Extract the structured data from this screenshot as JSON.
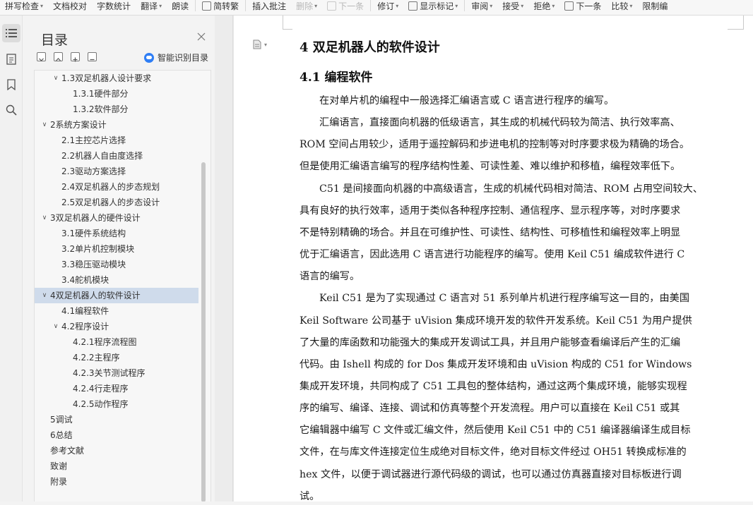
{
  "toolbar": {
    "items": [
      {
        "label": "拼写检查",
        "caret": true,
        "disabled": false,
        "icon": false
      },
      {
        "label": "文档校对",
        "caret": false,
        "disabled": false,
        "icon": false
      },
      {
        "label": "字数统计",
        "caret": false,
        "disabled": false,
        "icon": false
      },
      {
        "label": "翻译",
        "caret": true,
        "disabled": false,
        "icon": false
      },
      {
        "label": "朗读",
        "caret": false,
        "disabled": false,
        "icon": false
      },
      {
        "label": "简转繁",
        "caret": false,
        "disabled": false,
        "icon": true
      },
      {
        "label": "插入批注",
        "caret": false,
        "disabled": false,
        "icon": false
      },
      {
        "label": "删除",
        "caret": true,
        "disabled": true,
        "icon": false
      },
      {
        "label": "下一条",
        "caret": false,
        "disabled": true,
        "icon": true
      },
      {
        "label": "修订",
        "caret": true,
        "disabled": false,
        "icon": false
      },
      {
        "label": "显示标记",
        "caret": true,
        "disabled": false,
        "icon": true
      },
      {
        "label": "审阅",
        "caret": true,
        "disabled": false,
        "icon": false
      },
      {
        "label": "接受",
        "caret": true,
        "disabled": false,
        "icon": false
      },
      {
        "label": "拒绝",
        "caret": true,
        "disabled": false,
        "icon": false
      },
      {
        "label": "下一条",
        "caret": false,
        "disabled": false,
        "icon": true
      },
      {
        "label": "比较",
        "caret": true,
        "disabled": false,
        "icon": false
      },
      {
        "label": "限制编",
        "caret": false,
        "disabled": false,
        "icon": false
      }
    ]
  },
  "toc": {
    "title": "目录",
    "smart_label": "智能识别目录",
    "items": [
      {
        "label": "1.3双足机器人设计要求",
        "level": 2,
        "expanded": true
      },
      {
        "label": "1.3.1硬件部分",
        "level": 3
      },
      {
        "label": "1.3.2软件部分",
        "level": 3
      },
      {
        "label": "2系统方案设计",
        "level": 1,
        "expanded": true
      },
      {
        "label": "2.1主控芯片选择",
        "level": 2
      },
      {
        "label": "2.2机器人自由度选择",
        "level": 2
      },
      {
        "label": "2.3驱动方案选择",
        "level": 2
      },
      {
        "label": "2.4双足机器人的步态规划",
        "level": 2
      },
      {
        "label": "2.5双足机器人的步态设计",
        "level": 2
      },
      {
        "label": "3双足机器人的硬件设计",
        "level": 1,
        "expanded": true
      },
      {
        "label": "3.1硬件系统结构",
        "level": 2
      },
      {
        "label": "3.2单片机控制模块",
        "level": 2
      },
      {
        "label": "3.3稳压驱动模块",
        "level": 2
      },
      {
        "label": "3.4舵机模块",
        "level": 2
      },
      {
        "label": "4双足机器人的软件设计",
        "level": 1,
        "expanded": true,
        "selected": true
      },
      {
        "label": "4.1编程软件",
        "level": 2
      },
      {
        "label": "4.2程序设计",
        "level": 2,
        "expanded": true
      },
      {
        "label": "4.2.1程序流程图",
        "level": 3
      },
      {
        "label": "4.2.2主程序",
        "level": 3
      },
      {
        "label": "4.2.3关节测试程序",
        "level": 3
      },
      {
        "label": "4.2.4行走程序",
        "level": 3
      },
      {
        "label": "4.2.5动作程序",
        "level": 3
      },
      {
        "label": "5调试",
        "level": 1
      },
      {
        "label": "6总结",
        "level": 1
      },
      {
        "label": "参考文献",
        "level": 1
      },
      {
        "label": "致谢",
        "level": 1
      },
      {
        "label": "附录",
        "level": 1
      }
    ]
  },
  "document": {
    "heading1": "4 双足机器人的软件设计",
    "heading2": "4.1 编程软件",
    "lines": [
      {
        "text": "在对单片机的编程中一般选择汇编语言或 C 语言进行程序的编写。",
        "indent": true
      },
      {
        "text": "汇编语言，直接面向机器的低级语言，其生成的机械代码较为简洁、执行效率高、",
        "indent": true
      },
      {
        "text": "ROM 空间占用较少，适用于遥控解码和步进电机的控制等对时序要求极为精确的场合。",
        "indent": false
      },
      {
        "text": "但是使用汇编语言编写的程序结构性差、可读性差、难以维护和移植，编程效率低下。",
        "indent": false
      },
      {
        "text": "C51 是间接面向机器的中高级语言，生成的机械代码相对简洁、ROM 占用空间较大、",
        "indent": true
      },
      {
        "text": "具有良好的执行效率，适用于类似各种程序控制、通信程序、显示程序等，对时序要求",
        "indent": false
      },
      {
        "text": "不是特别精确的场合。并且在可维护性、可读性、结构性、可移植性和编程效率上明显",
        "indent": false
      },
      {
        "text": "优于汇编语言，因此选用 C 语言进行功能程序的编写。使用 Keil C51 编成软件进行 C",
        "indent": false
      },
      {
        "text": "语言的编写。",
        "indent": false
      },
      {
        "text": "Keil C51 是为了实现通过 C 语言对 51 系列单片机进行程序编写这一目的，由美国",
        "indent": true
      },
      {
        "text": "Keil Software 公司基于 uVision 集成环境开发的软件开发系统。Keil C51 为用户提供",
        "indent": false
      },
      {
        "text": "了大量的库函数和功能强大的集成开发调试工具，并且用户能够查看编译后产生的汇编",
        "indent": false
      },
      {
        "text": "代码。由 Ishell 构成的 for Dos 集成开发环境和由 uVision 构成的 C51 for Windows",
        "indent": false
      },
      {
        "text": "集成开发环境，共同构成了 C51 工具包的整体结构，通过这两个集成环境，能够实现程",
        "indent": false
      },
      {
        "text": "序的编写、编译、连接、调试和仿真等整个开发流程。用户可以直接在 Keil C51 或其",
        "indent": false
      },
      {
        "text": "它编辑器中编写 C 文件或汇编文件，然后使用 Keil C51 中的 C51 编译器编译生成目标",
        "indent": false
      },
      {
        "text": "文件，在与库文件连接定位生成绝对目标文件，绝对目标文件经过 OH51 转换成标准的",
        "indent": false
      },
      {
        "text": "hex 文件，以便于调试器进行源代码级的调试，也可以通过仿真器直接对目标板进行调",
        "indent": false
      },
      {
        "text": "试。",
        "indent": false
      }
    ]
  }
}
